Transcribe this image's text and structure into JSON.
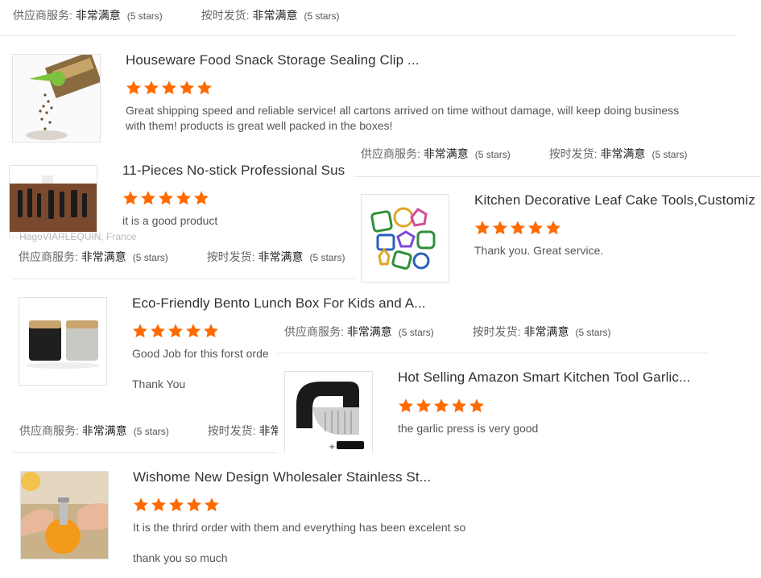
{
  "rating_labels": {
    "supplier_key": "供应商服务:",
    "shipping_key": "按时发货:",
    "value": "非常满意",
    "stars_text": "(5 stars)"
  },
  "colors": {
    "star": "#ff6a00"
  },
  "reviews": [
    {
      "title": "Houseware Food Snack Storage Sealing Clip ...",
      "rating": 5,
      "text": "Great shipping speed and reliable service! all cartons arrived on time without damage, will keep doing business with them! products is great well packed in the boxes!",
      "thumb_icon": "sealing-clip-image"
    },
    {
      "title": "11-Pieces No-stick Professional Sus",
      "rating": 5,
      "text": "it is a good product",
      "ghost": "HagoVIARLEQUIN, France",
      "thumb_icon": "utensil-set-image"
    },
    {
      "title": "Kitchen Decorative Leaf Cake Tools,Customiz",
      "rating": 5,
      "text": "Thank you. Great service.",
      "thumb_icon": "cookie-cutters-image"
    },
    {
      "title": "Eco-Friendly Bento Lunch Box For Kids and A...",
      "rating": 5,
      "text": "Good Job for this forst orde",
      "text2": "Thank You",
      "thumb_icon": "bento-box-image"
    },
    {
      "title": "Hot Selling Amazon Smart Kitchen Tool Garlic...",
      "rating": 5,
      "text": "the garlic press is very good",
      "thumb_icon": "garlic-press-image"
    },
    {
      "title": "Wishome New Design Wholesaler Stainless St...",
      "rating": 5,
      "text": "It is the thrird order with them and everything has been excelent so",
      "text2": "thank you so much",
      "thumb_icon": "citrus-sprayer-image"
    }
  ]
}
